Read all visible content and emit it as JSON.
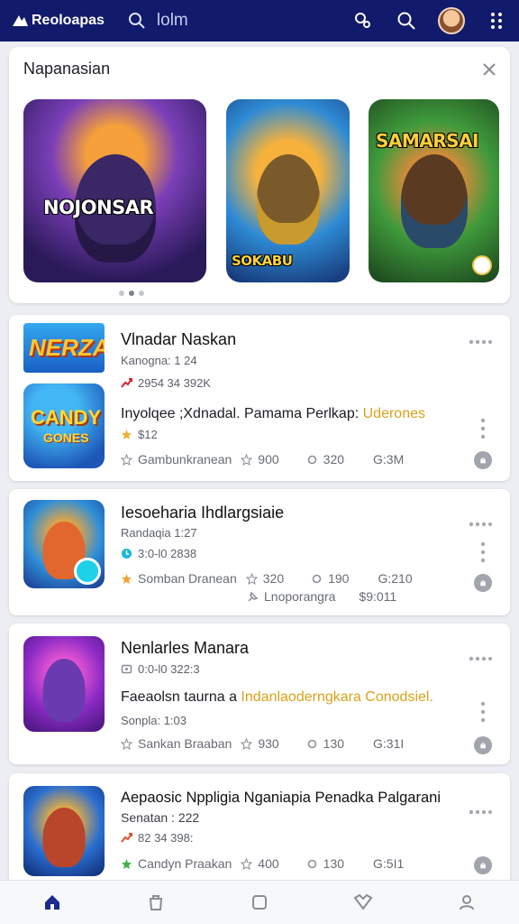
{
  "app": {
    "name": "Reoloapas"
  },
  "topbar": {
    "search_text": "lolm",
    "icons": [
      "search-icon",
      "settings-icon",
      "avatar",
      "apps-grid-icon"
    ]
  },
  "featured": {
    "title": "Napanasian",
    "tiles": [
      {
        "caption": "NOJONSAR",
        "icon": "hero-art"
      },
      {
        "caption": "SOKABU",
        "icon": "hero-art"
      },
      {
        "caption": "SAMARSAI",
        "icon": "hero-art"
      }
    ],
    "page_count": 3,
    "active_page": 2
  },
  "items": [
    {
      "title": "Vlnadar Naskan",
      "sub1": "Kanogna: 1 24",
      "sub2": "2954 34 392K",
      "sub2_icon": "trending-up-icon",
      "desc": "Inyolqee ;Xdnadal. Pamama Perlkap: ",
      "desc_highlight": "Uderones",
      "sub3": "$12",
      "sub3_icon": "star-icon",
      "thumb_top_caption": "NERZA",
      "thumb_caption_1": "CANDY",
      "thumb_caption_2": "GONES",
      "stats": [
        "Gambunkranean",
        "900",
        "320",
        "G:3M"
      ]
    },
    {
      "title": "Iesoeharia Ihdlargsiaie",
      "sub1": "Randaqia 1:27",
      "sub2": "3:0-l0 2838",
      "sub2_icon": "clock-icon",
      "stats": [
        "Somban Dranean",
        "320",
        "190",
        "G:210"
      ],
      "extra_stats": [
        "Lnoporangra",
        "$9:011"
      ]
    },
    {
      "title": "Nenlarles Manara",
      "sub1": "0:0-l0 322:3",
      "sub1_icon": "tag-icon",
      "desc": "Faeaolsn taurna a ",
      "desc_highlight": "Indanlaoderngkara Conodsiel.",
      "sub2": "Sonpla: 1:03",
      "stats": [
        "Sankan Braaban",
        "930",
        "130",
        "G:31I"
      ]
    },
    {
      "title": "Aepaosic Nppligia Nganiapia Penadka Palgarani",
      "sub1": "Senatan : 222",
      "sub2": "82 34 398:",
      "sub2_icon": "trending-up-icon",
      "stats": [
        "Candyn Praakan",
        "400",
        "130",
        "G:5I1"
      ]
    }
  ],
  "bottom_nav": {
    "items": [
      "home-icon",
      "store-icon",
      "square-icon",
      "heart-icon",
      "profile-icon"
    ],
    "active": 0
  },
  "colors": {
    "topbar": "#121a6b",
    "accent": "#d9a21b",
    "nav_active": "#1d2b8f"
  }
}
